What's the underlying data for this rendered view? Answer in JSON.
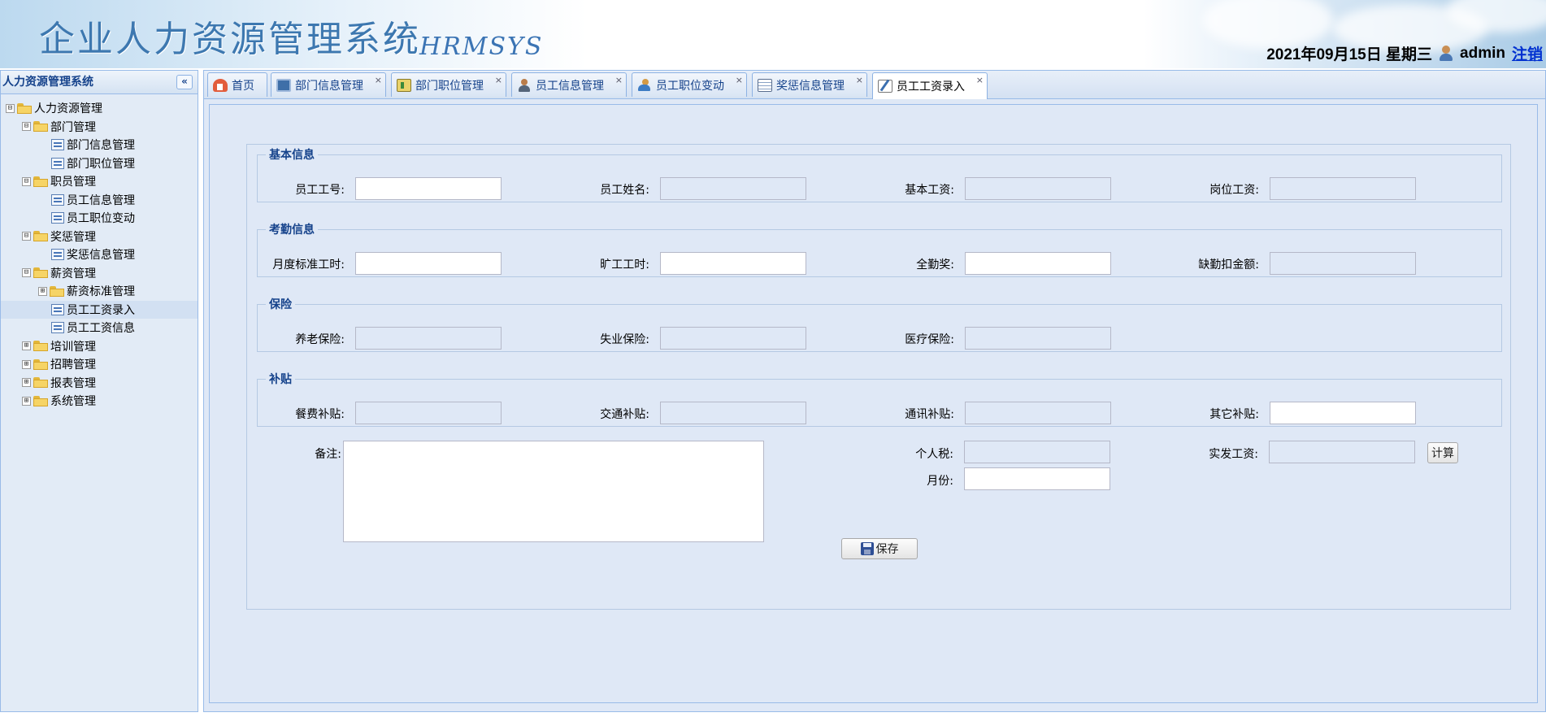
{
  "header": {
    "app_title": "企业人力资源管理系统",
    "app_subtitle": "HRMSYS",
    "date_text": "2021年09月15日 星期三",
    "username": "admin",
    "logout_label": "注销"
  },
  "sidebar": {
    "title": "人力资源管理系统",
    "collapse_glyph": "«",
    "tree": [
      {
        "label": "人力资源管理",
        "toggle": "⊟"
      },
      {
        "label": "部门管理",
        "toggle": "⊟"
      },
      {
        "label": "部门信息管理"
      },
      {
        "label": "部门职位管理"
      },
      {
        "label": "职员管理",
        "toggle": "⊟"
      },
      {
        "label": "员工信息管理"
      },
      {
        "label": "员工职位变动"
      },
      {
        "label": "奖惩管理",
        "toggle": "⊟"
      },
      {
        "label": "奖惩信息管理"
      },
      {
        "label": "薪资管理",
        "toggle": "⊟"
      },
      {
        "label": "薪资标准管理",
        "toggle": "⊞"
      },
      {
        "label": "员工工资录入"
      },
      {
        "label": "员工工资信息"
      },
      {
        "label": "培训管理",
        "toggle": "⊞"
      },
      {
        "label": "招聘管理",
        "toggle": "⊞"
      },
      {
        "label": "报表管理",
        "toggle": "⊞"
      },
      {
        "label": "系统管理",
        "toggle": "⊞"
      }
    ]
  },
  "tabs": [
    {
      "label": "首页",
      "icon": "home-icon"
    },
    {
      "label": "部门信息管理",
      "icon": "monitor-icon",
      "close": "×"
    },
    {
      "label": "部门职位管理",
      "icon": "book-icon",
      "close": "×"
    },
    {
      "label": "员工信息管理",
      "icon": "person-icon",
      "close": "×"
    },
    {
      "label": "员工职位变动",
      "icon": "person-move-icon",
      "close": "×"
    },
    {
      "label": "奖惩信息管理",
      "icon": "table-icon",
      "close": "×"
    },
    {
      "label": "员工工资录入",
      "icon": "edit-icon",
      "close": "×"
    }
  ],
  "form": {
    "basic": {
      "legend": "基本信息",
      "emp_no_label": "员工工号:",
      "emp_name_label": "员工姓名:",
      "base_salary_label": "基本工资:",
      "post_salary_label": "岗位工资:"
    },
    "attendance": {
      "legend": "考勤信息",
      "std_hours_label": "月度标准工时:",
      "absent_hours_label": "旷工工时:",
      "full_att_label": "全勤奖:",
      "deduction_label": "缺勤扣金额:"
    },
    "insurance": {
      "legend": "保险",
      "pension_label": "养老保险:",
      "unemployment_label": "失业保险:",
      "medical_label": "医疗保险:"
    },
    "allowance": {
      "legend": "补贴",
      "meal_label": "餐费补贴:",
      "transport_label": "交通补贴:",
      "comm_label": "通讯补贴:",
      "other_label": "其它补贴:"
    },
    "remark_label": "备注:",
    "tax_label": "个人税:",
    "net_pay_label": "实发工资:",
    "month_label": "月份:",
    "calc_label": "计算",
    "save_label": "保存"
  },
  "colors": {
    "accent": "#15428b",
    "panel_bg": "#dfe8f6",
    "border": "#99bbe8",
    "logout_link": "#0030d0"
  }
}
